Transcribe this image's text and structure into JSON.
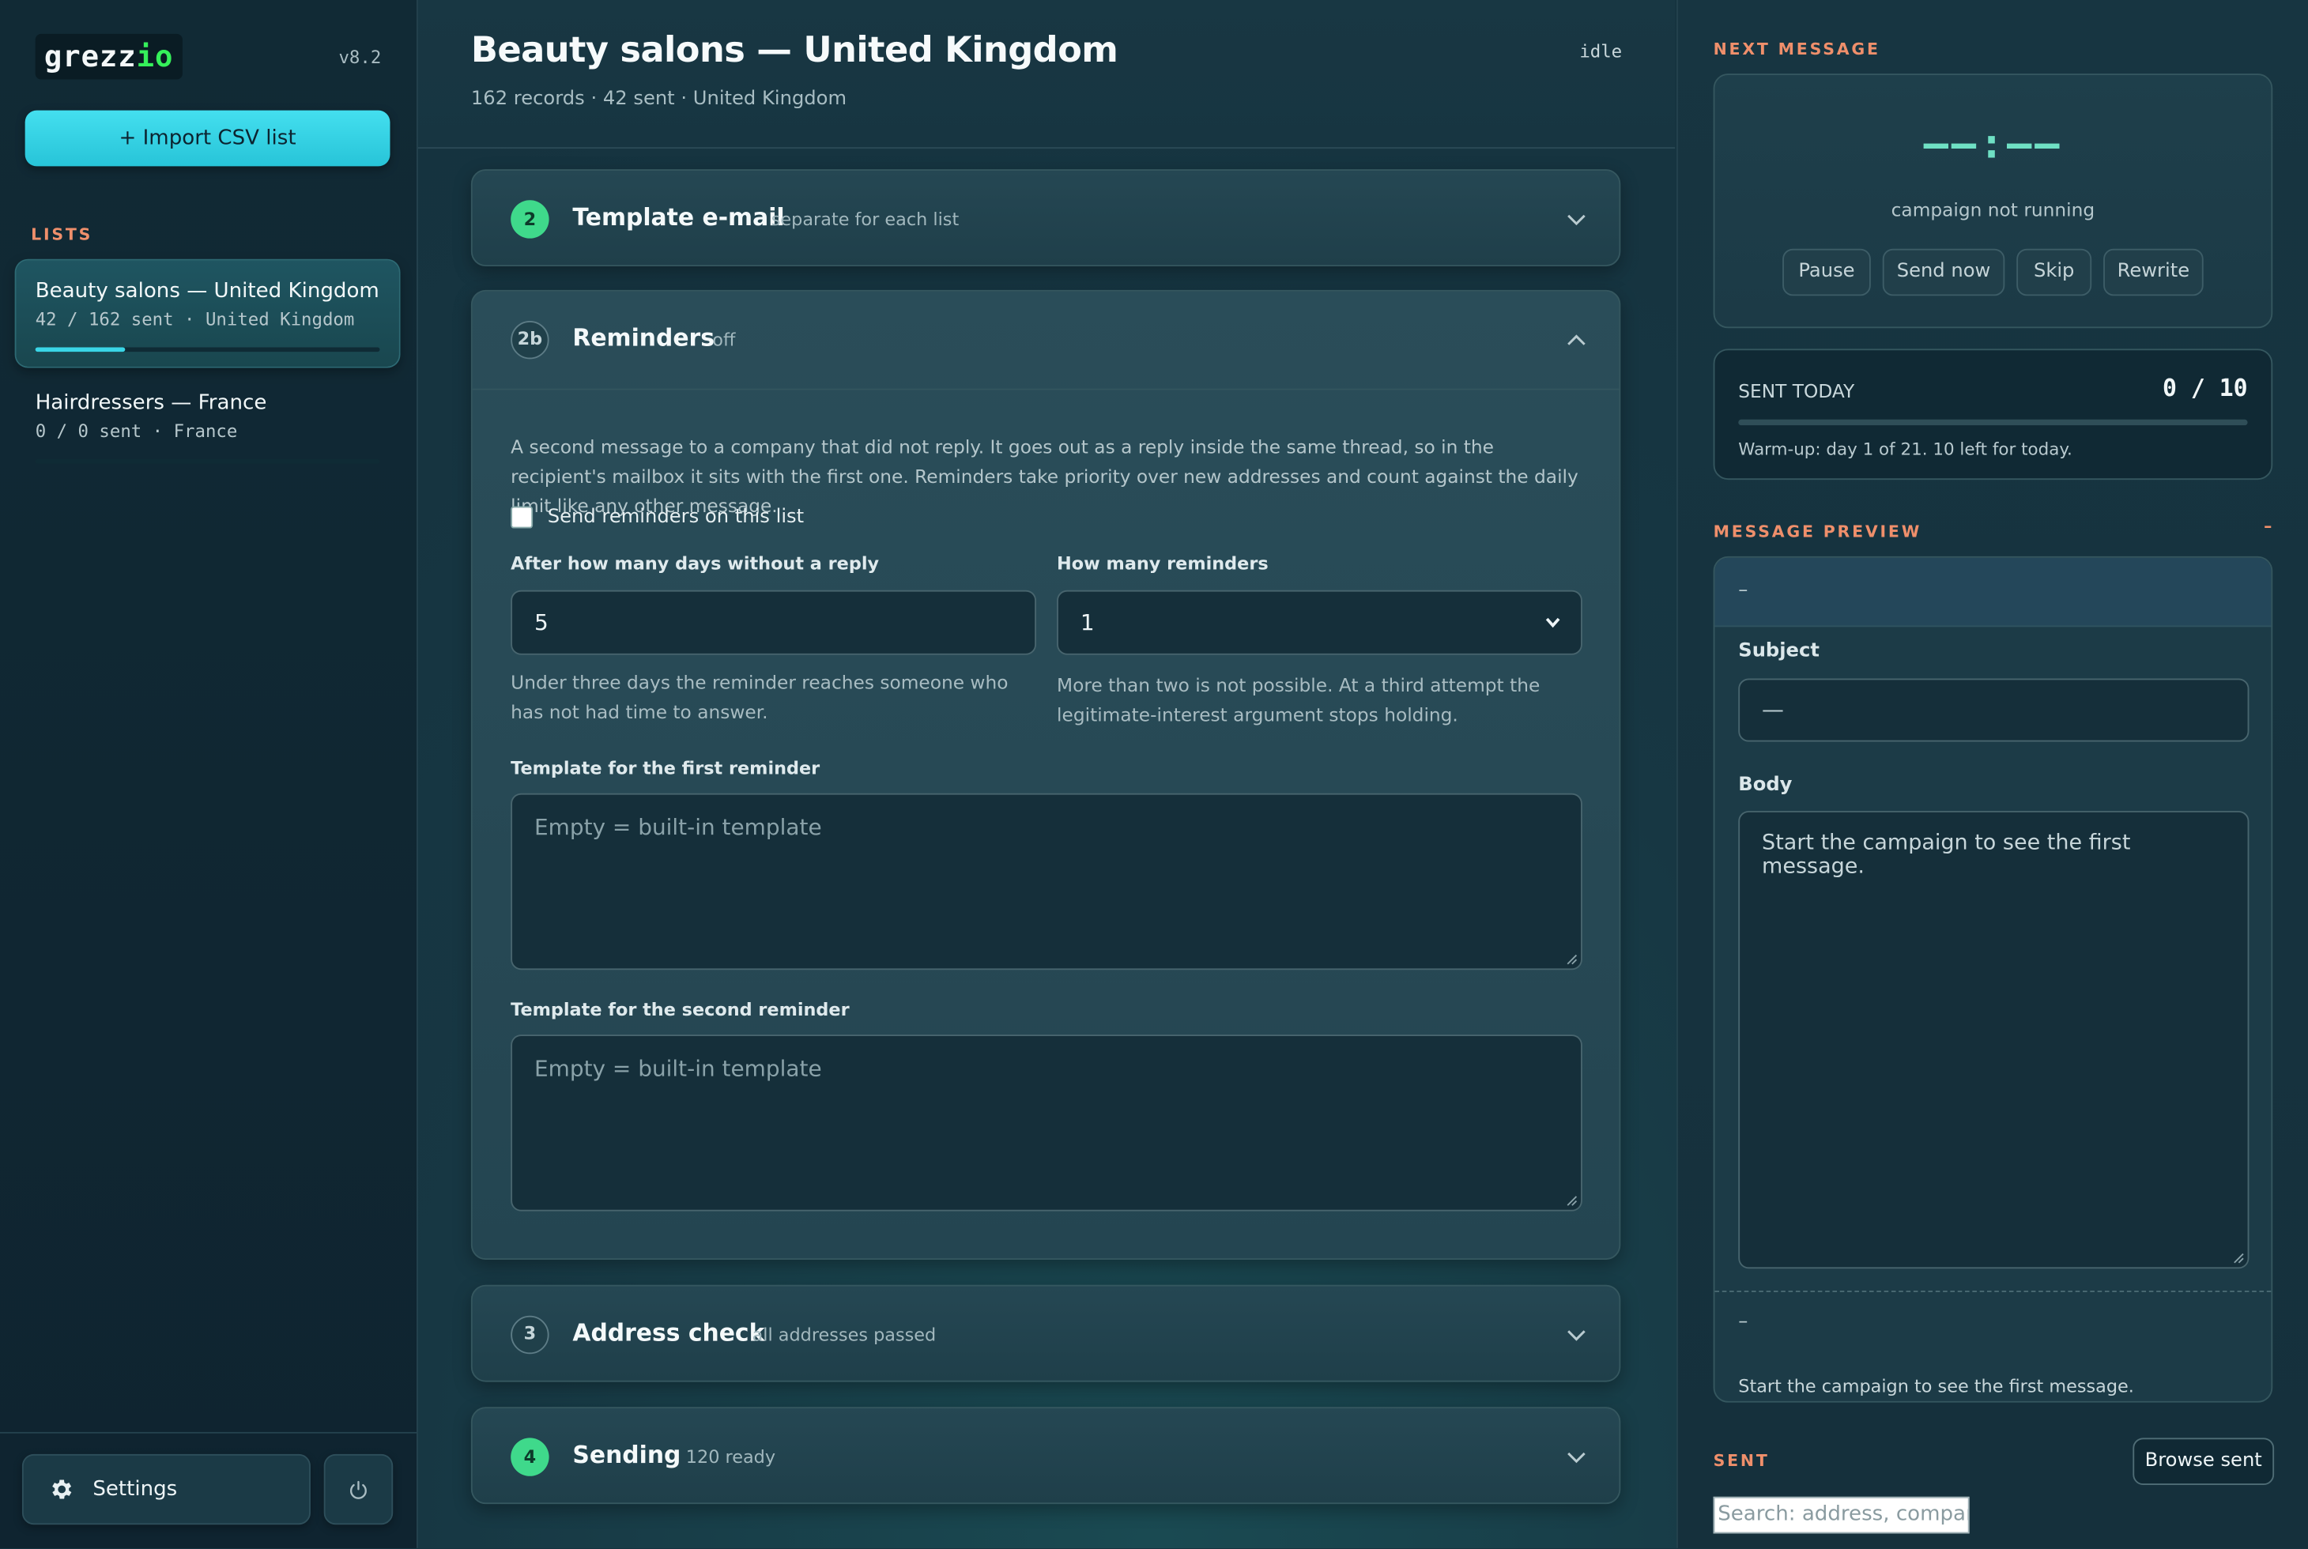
{
  "sidebar": {
    "logo_text": "grezz",
    "logo_accent": "io",
    "version": "v8.2",
    "import_label": "+ Import CSV list",
    "lists_label": "LISTS",
    "lists": [
      {
        "name": "Beauty salons — United Kingdom",
        "meta": "42 / 162 sent · United Kingdom",
        "progress": 0.26,
        "active": true
      },
      {
        "name": "Hairdressers — France",
        "meta": "0 / 0 sent · France",
        "progress": 0,
        "active": false
      }
    ],
    "settings_label": "Settings"
  },
  "header": {
    "title": "Beauty salons — United Kingdom",
    "subtitle": "162 records · 42 sent · United Kingdom",
    "status": "idle"
  },
  "cards": {
    "template": {
      "step": "2",
      "title": "Template e-mail",
      "sub": "separate for each list"
    },
    "reminders": {
      "step": "2b",
      "title": "Reminders",
      "sub": "off",
      "description": "A second message to a company that did not reply. It goes out as a reply inside the same thread, so in the recipient's mailbox it sits with the first one. Reminders take priority over new addresses and count against the daily limit like any other message.",
      "checkbox_label": "Send reminders on this list",
      "checked": false,
      "days_label": "After how many days without a reply",
      "days_value": "5",
      "days_hint": "Under three days the reminder reaches someone who has not had time to answer.",
      "count_label": "How many reminders",
      "count_value": "1",
      "count_hint": "More than two is not possible. At a third attempt the legitimate-interest argument stops holding.",
      "first_label": "Template for the first reminder",
      "first_placeholder": "Empty = built-in template",
      "second_label": "Template for the second reminder",
      "second_placeholder": "Empty = built-in template"
    },
    "address": {
      "step": "3",
      "title": "Address check",
      "sub": "all addresses passed"
    },
    "sending": {
      "step": "4",
      "title": "Sending",
      "sub": "120 ready"
    }
  },
  "right": {
    "next_label": "NEXT MESSAGE",
    "timer": "——:——",
    "not_running": "campaign not running",
    "buttons": [
      "Pause",
      "Send now",
      "Skip",
      "Rewrite"
    ],
    "sent_today_label": "SENT TODAY",
    "sent_today_value": "0 / 10",
    "sent_today_fraction": 0,
    "warmup_note": "Warm-up: day 1 of 21. 10 left for today.",
    "preview_label": "MESSAGE PREVIEW",
    "preview_collapse": "–",
    "preview_top": "–",
    "subject_label": "Subject",
    "subject_value": "—",
    "body_label": "Body",
    "body_value": "Start the campaign to see the first message.",
    "footer_dash": "–",
    "footer_text": "Start the campaign to see the first message.",
    "sent_label": "SENT",
    "browse_label": "Browse sent",
    "search_placeholder": "Search: address, company"
  },
  "colors": {
    "accent": "#3ad6e7",
    "step_green": "#3fd98b",
    "section_label": "#ef8f6b",
    "logo_green": "#35f05a"
  }
}
